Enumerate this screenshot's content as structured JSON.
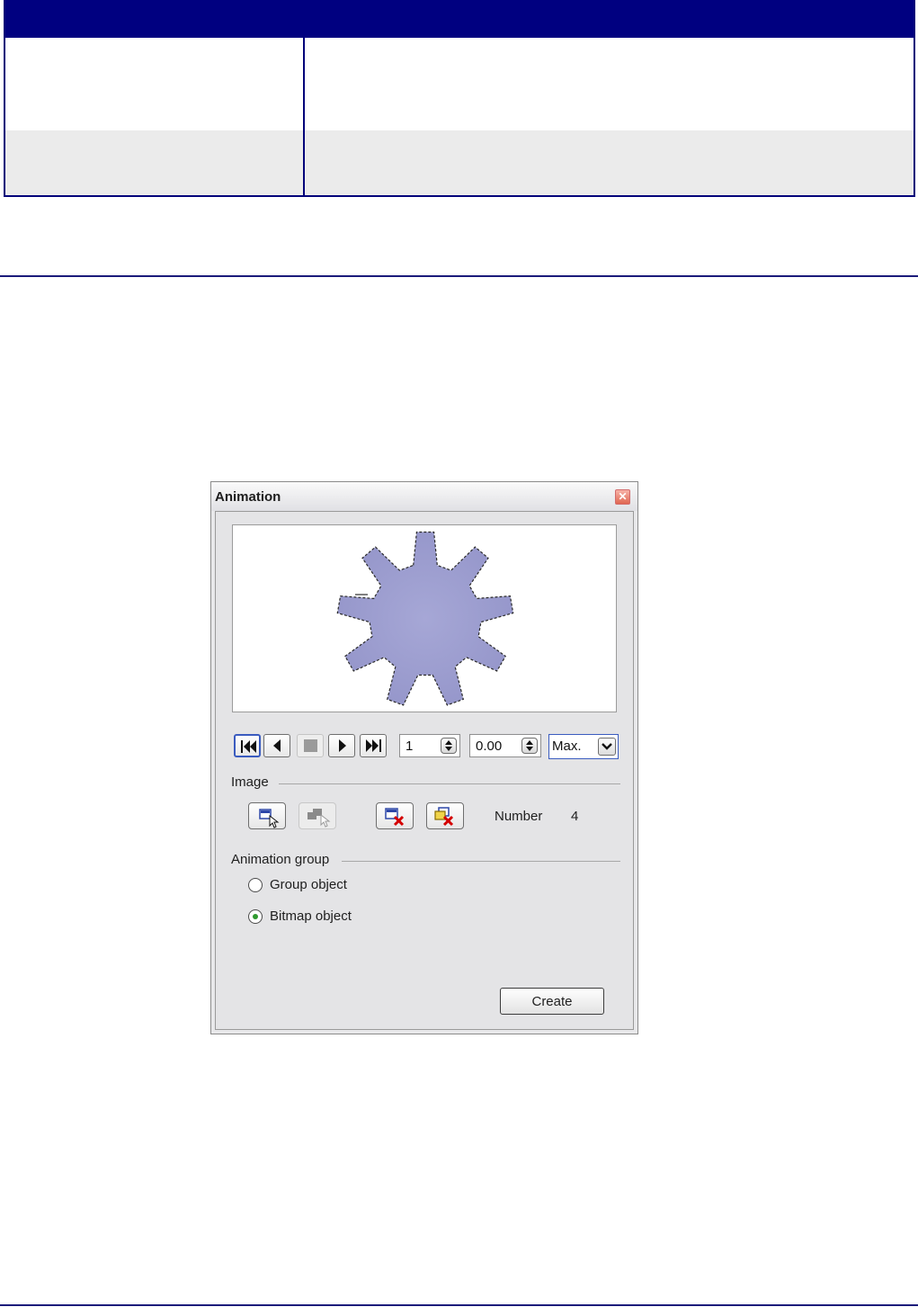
{
  "dialog": {
    "title": "Animation",
    "close_glyph": "✕",
    "playback": {
      "buttons": [
        "first-frame-icon",
        "previous-frame-icon",
        "stop-icon",
        "play-icon",
        "last-frame-icon"
      ],
      "frame_value": "1",
      "duration_value": "0.00",
      "loop_value": "Max."
    },
    "image_group": {
      "label": "Image",
      "buttons": [
        "apply-object-icon",
        "apply-objects-individually-icon",
        "delete-current-image-icon",
        "delete-all-images-icon"
      ],
      "number_label": "Number",
      "number_value": "4"
    },
    "animation_group": {
      "label": "Animation group",
      "options": [
        {
          "label": "Group object",
          "checked": false
        },
        {
          "label": "Bitmap object",
          "checked": true
        }
      ]
    },
    "create_label": "Create"
  },
  "colors": {
    "table_header": "#000080",
    "star_fill": "#9fa0d0",
    "accent_blue": "#3a5bbf"
  }
}
